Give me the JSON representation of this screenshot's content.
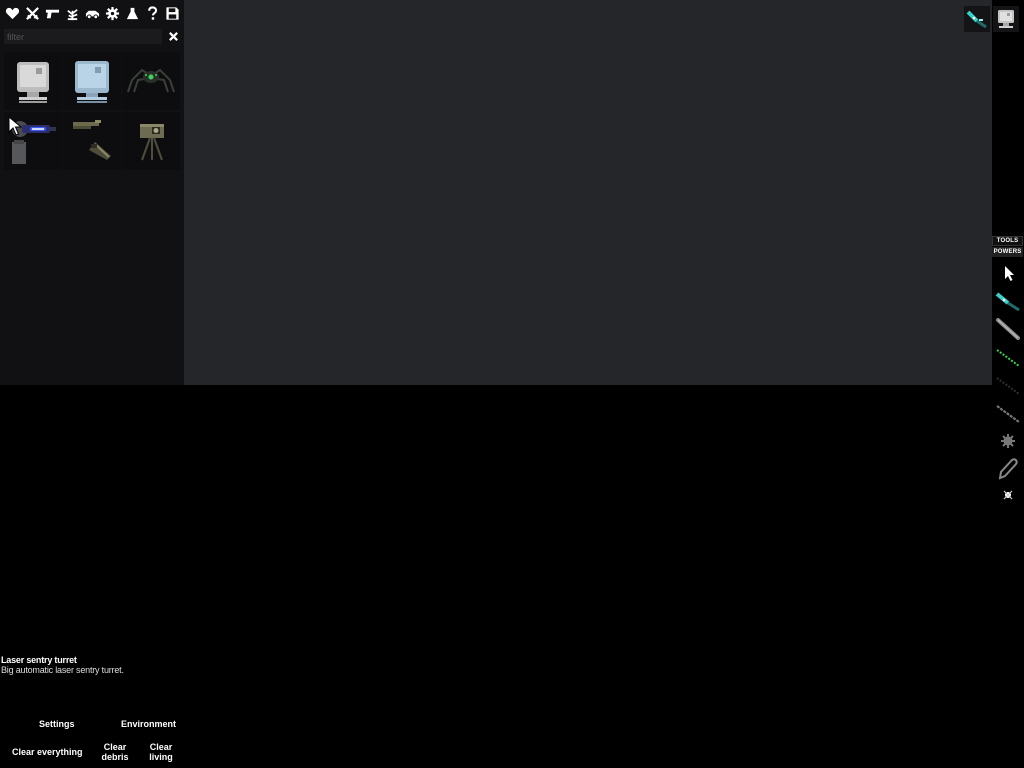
{
  "categories": [
    {
      "name": "heart-icon"
    },
    {
      "name": "crossed-swords-icon"
    },
    {
      "name": "gun-icon"
    },
    {
      "name": "plant-icon"
    },
    {
      "name": "vehicle-icon"
    },
    {
      "name": "gear-icon"
    },
    {
      "name": "flask-icon"
    },
    {
      "name": "help-icon"
    },
    {
      "name": "save-icon"
    }
  ],
  "filter": {
    "placeholder": "filter",
    "value": ""
  },
  "items": [
    {
      "icon": "grey-computer-icon"
    },
    {
      "icon": "blue-computer-icon"
    },
    {
      "icon": "spider-bot-icon"
    },
    {
      "icon": "laser-sentry-turret-icon"
    },
    {
      "icon": "rifle-parts-icon"
    },
    {
      "icon": "camera-tripod-icon"
    }
  ],
  "top_right": [
    {
      "icon": "syringe-tool-icon"
    },
    {
      "icon": "computer-contraption-icon"
    }
  ],
  "side_panel": {
    "tabs": {
      "tools": "TOOLS",
      "powers": "POWERS"
    },
    "tools": [
      {
        "icon": "pointer-icon"
      },
      {
        "icon": "syringe-tool-icon"
      },
      {
        "icon": "rod-tool-icon"
      },
      {
        "icon": "green-wire-icon"
      },
      {
        "icon": "dark-wire-icon"
      },
      {
        "icon": "chain-icon"
      },
      {
        "icon": "gear-small-icon"
      },
      {
        "icon": "rope-loop-icon"
      },
      {
        "icon": "pin-icon"
      }
    ]
  },
  "description": {
    "name": "Laser sentry turret",
    "text": "Big automatic laser sentry turret."
  },
  "buttons": {
    "settings": "Settings",
    "environment": "Environment",
    "clear_everything": "Clear everything",
    "clear_debris": "Clear debris",
    "clear_living": "Clear living"
  },
  "colors": {
    "scene": "#25262a",
    "panel": "#111113",
    "accent_cyan": "#3ad0c9",
    "accent_green": "#38d44a",
    "turret_blue": "#3e5bff"
  }
}
